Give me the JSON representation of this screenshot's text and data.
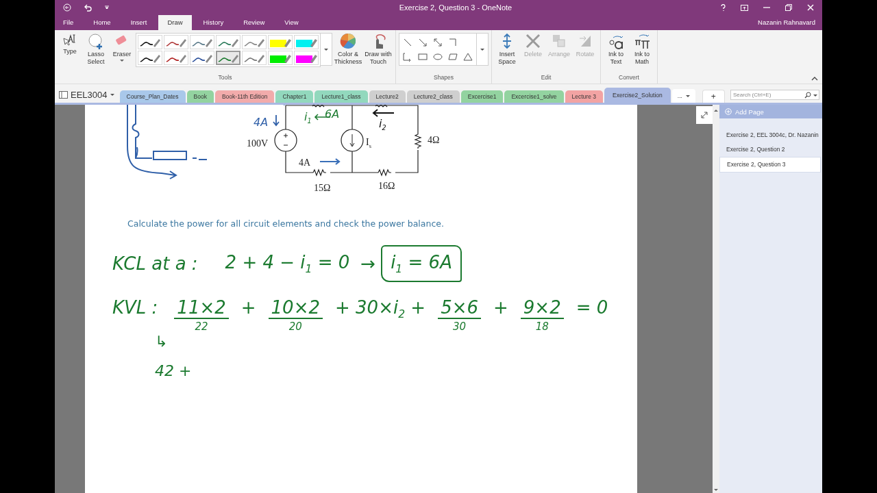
{
  "window": {
    "title": "Exercise 2, Question 3 - OneNote",
    "user": "Nazanin Rahnavard"
  },
  "ribbon_tabs": [
    {
      "label": "File",
      "selected": false
    },
    {
      "label": "Home",
      "selected": false
    },
    {
      "label": "Insert",
      "selected": false
    },
    {
      "label": "Draw",
      "selected": true
    },
    {
      "label": "History",
      "selected": false
    },
    {
      "label": "Review",
      "selected": false
    },
    {
      "label": "View",
      "selected": false
    }
  ],
  "tools_group": {
    "label": "Tools",
    "buttons": [
      {
        "label": "Type"
      },
      {
        "label": "Lasso Select"
      },
      {
        "label": "Eraser"
      }
    ],
    "pens": [
      {
        "kind": "pen",
        "color": "#111111",
        "selected": false
      },
      {
        "kind": "pen",
        "color": "#b03a3a",
        "selected": false
      },
      {
        "kind": "pen",
        "color": "#5a7a8a",
        "selected": false
      },
      {
        "kind": "pen",
        "color": "#2a7a5a",
        "selected": false
      },
      {
        "kind": "pen",
        "color": "#888888",
        "selected": false
      },
      {
        "kind": "highlighter",
        "color": "#ffff00",
        "selected": false
      },
      {
        "kind": "highlighter",
        "color": "#00f0f0",
        "selected": false
      },
      {
        "kind": "pen",
        "color": "#111111",
        "selected": false
      },
      {
        "kind": "pen",
        "color": "#b02020",
        "selected": false
      },
      {
        "kind": "pen",
        "color": "#2a4f9a",
        "selected": false
      },
      {
        "kind": "pen",
        "color": "#1b7a2f",
        "selected": true
      },
      {
        "kind": "pen",
        "color": "#777777",
        "selected": false
      },
      {
        "kind": "highlighter",
        "color": "#00ee00",
        "selected": false
      },
      {
        "kind": "highlighter",
        "color": "#ff00ff",
        "selected": false
      }
    ],
    "more_buttons": [
      {
        "label": "Color & Thickness"
      },
      {
        "label": "Draw with Touch"
      }
    ]
  },
  "shapes_group": {
    "label": "Shapes"
  },
  "edit_group": {
    "label": "Edit",
    "buttons": [
      {
        "label": "Insert Space",
        "disabled": false
      },
      {
        "label": "Delete",
        "disabled": true
      },
      {
        "label": "Arrange",
        "disabled": true
      },
      {
        "label": "Rotate",
        "disabled": true
      }
    ]
  },
  "convert_group": {
    "label": "Convert",
    "buttons": [
      {
        "label": "Ink to Text"
      },
      {
        "label": "Ink to Math"
      }
    ]
  },
  "notebook": {
    "name": "EEL3004"
  },
  "sections": [
    {
      "label": "Course_Plan_Dates",
      "color": "#a9c8ea",
      "selected": false
    },
    {
      "label": "Book",
      "color": "#93d3a0",
      "selected": false
    },
    {
      "label": "Book-11th Edition",
      "color": "#f2abab",
      "selected": false
    },
    {
      "label": "Chapter1",
      "color": "#92d8bd",
      "selected": false
    },
    {
      "label": "Lecture1_class",
      "color": "#92d8bd",
      "selected": false
    },
    {
      "label": "Lecture2",
      "color": "#cfcfcf",
      "selected": false
    },
    {
      "label": "Lecture2_class",
      "color": "#cfcfcf",
      "selected": false
    },
    {
      "label": "Excercise1",
      "color": "#93d3a0",
      "selected": false
    },
    {
      "label": "Excercise1_solve",
      "color": "#93d3a0",
      "selected": false
    },
    {
      "label": "Lecture 3",
      "color": "#f2a3a3",
      "selected": false
    },
    {
      "label": "Exercise2_Solution",
      "color": "#aab9e2",
      "selected": true
    }
  ],
  "more_sections": "...",
  "new_section": "+",
  "search": {
    "placeholder": "Search (Ctrl+E)"
  },
  "circuit": {
    "labels": [
      {
        "text": "100V",
        "kind": "printed"
      },
      {
        "text": "I$_{s}$",
        "kind": "printed"
      },
      {
        "text": "4Ω",
        "kind": "printed"
      },
      {
        "text": "15Ω",
        "kind": "printed"
      },
      {
        "text": "16Ω",
        "kind": "printed"
      },
      {
        "text": "4A",
        "kind": "printed"
      },
      {
        "text": "4A",
        "kind": "ink",
        "color": "#2f5fa8"
      },
      {
        "text": "i$_{1}$",
        "kind": "ink",
        "color": "#1b7a2f"
      },
      {
        "text": "6A",
        "kind": "ink",
        "color": "#1b7a2f"
      },
      {
        "text": "i$_{2}$",
        "kind": "ink",
        "color": "#111111"
      }
    ]
  },
  "prompt": "Calculate the power for all circuit elements and check the power balance.",
  "kcl": {
    "label": "KCL at a :",
    "equation": "2 + 4 − i$_{1}$ = 0",
    "arrow": "→",
    "result": "i$_{1}$ = 6A"
  },
  "kvl": {
    "label": "KVL :",
    "terms": [
      {
        "text": "11×2",
        "under": "22"
      },
      {
        "text": "+"
      },
      {
        "text": "10×2",
        "under": "20"
      },
      {
        "text": "+ 30×i$_{2}$ +"
      },
      {
        "text": "5×6",
        "under": "30"
      },
      {
        "text": "+"
      },
      {
        "text": "9×2",
        "under": "18"
      },
      {
        "text": "= 0"
      }
    ]
  },
  "next_lines": [
    "↳",
    "42 +"
  ],
  "pages": {
    "add_label": "Add Page",
    "items": [
      {
        "title": "Exercise 2, EEL 3004c, Dr. Nazanin",
        "selected": false
      },
      {
        "title": "Exercise 2, Question 2",
        "selected": false
      },
      {
        "title": "Exercise 2, Question 3",
        "selected": true
      }
    ]
  }
}
